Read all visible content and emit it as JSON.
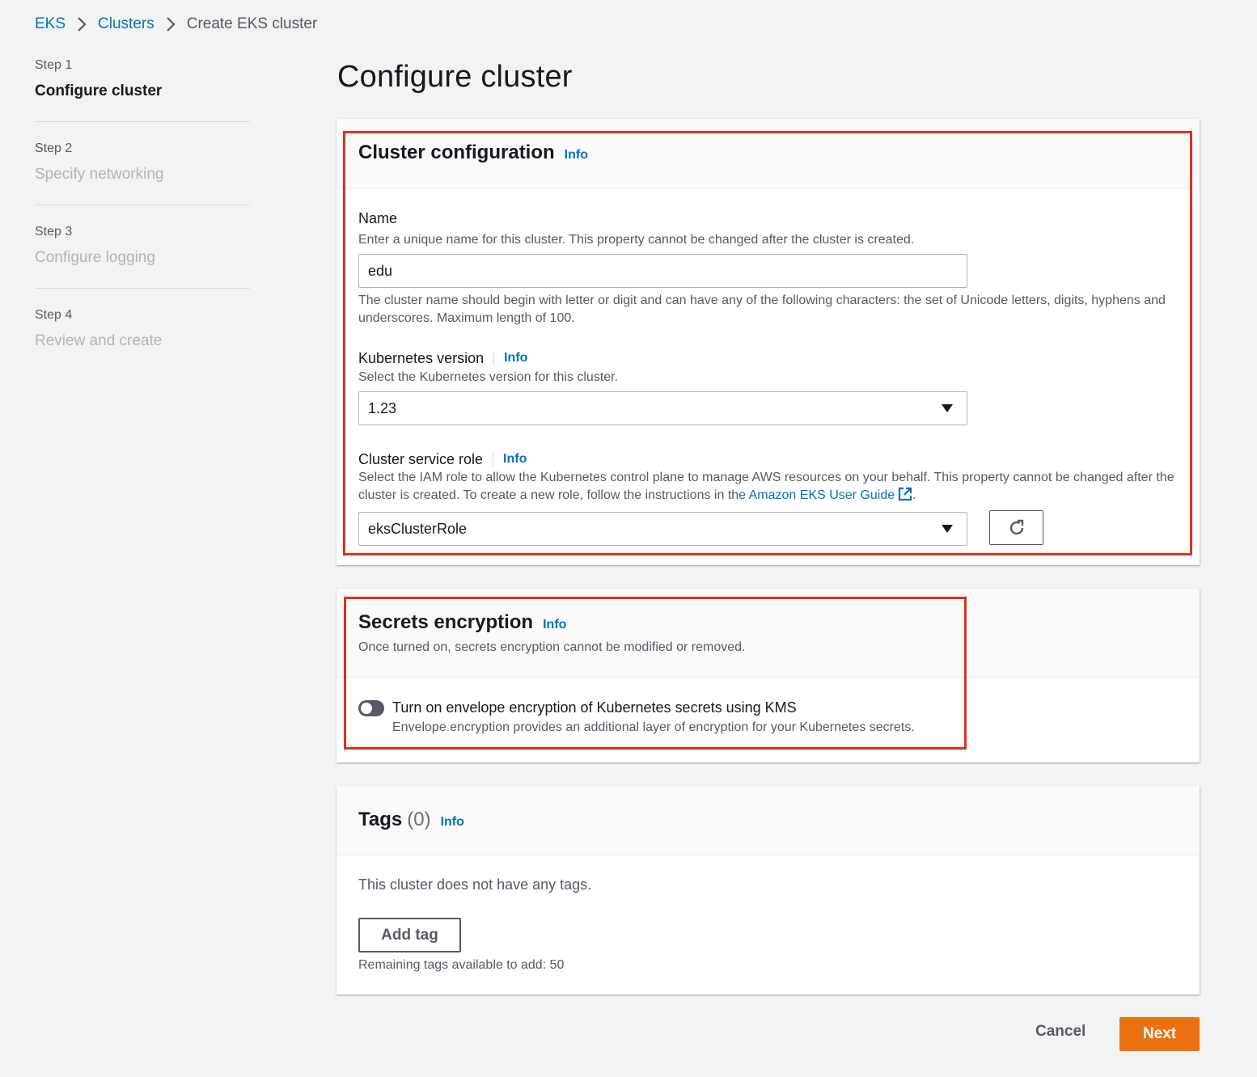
{
  "breadcrumb": {
    "items": [
      "EKS",
      "Clusters"
    ],
    "current": "Create EKS cluster"
  },
  "steps": [
    {
      "num": "Step 1",
      "title": "Configure cluster",
      "active": true
    },
    {
      "num": "Step 2",
      "title": "Specify networking",
      "active": false
    },
    {
      "num": "Step 3",
      "title": "Configure logging",
      "active": false
    },
    {
      "num": "Step 4",
      "title": "Review and create",
      "active": false
    }
  ],
  "page_title": "Configure cluster",
  "cluster_config": {
    "title": "Cluster configuration",
    "info": "Info",
    "name": {
      "label": "Name",
      "description": "Enter a unique name for this cluster. This property cannot be changed after the cluster is created.",
      "value": "edu",
      "constraint": "The cluster name should begin with letter or digit and can have any of the following characters: the set of Unicode letters, digits, hyphens and underscores. Maximum length of 100."
    },
    "k8s_version": {
      "label": "Kubernetes version",
      "info": "Info",
      "description": "Select the Kubernetes version for this cluster.",
      "value": "1.23"
    },
    "service_role": {
      "label": "Cluster service role",
      "info": "Info",
      "description_prefix": "Select the IAM role to allow the Kubernetes control plane to manage AWS resources on your behalf. This property cannot be changed after the cluster is created. To create a new role, follow the instructions in the ",
      "guide_link": "Amazon EKS User Guide",
      "description_suffix": ".",
      "value": "eksClusterRole"
    }
  },
  "secrets": {
    "title": "Secrets encryption",
    "info": "Info",
    "description": "Once turned on, secrets encryption cannot be modified or removed.",
    "toggle_label": "Turn on envelope encryption of Kubernetes secrets using KMS",
    "toggle_desc": "Envelope encryption provides an additional layer of encryption for your Kubernetes secrets.",
    "toggle_on": false
  },
  "tags": {
    "title": "Tags",
    "count": "(0)",
    "info": "Info",
    "empty": "This cluster does not have any tags.",
    "add_button": "Add tag",
    "remaining": "Remaining tags available to add: 50"
  },
  "footer": {
    "cancel": "Cancel",
    "next": "Next"
  },
  "colors": {
    "link": "#0073bb",
    "primary_button": "#ec7211",
    "annotation": "#e0301e"
  }
}
